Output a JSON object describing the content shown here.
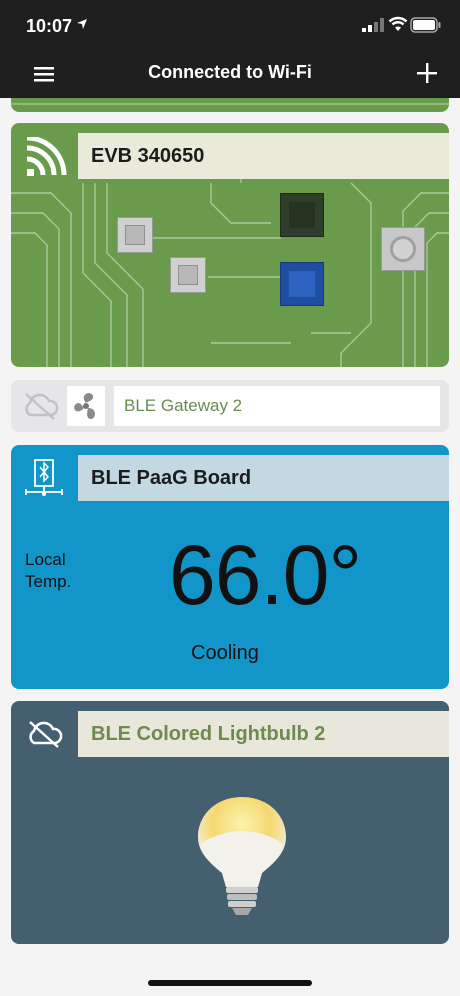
{
  "status_bar": {
    "time": "10:07"
  },
  "nav": {
    "title": "Connected to Wi-Fi"
  },
  "devices": {
    "evb": {
      "name": "EVB 340650"
    },
    "gateway": {
      "name": "BLE Gateway 2"
    },
    "paag": {
      "name": "BLE PaaG Board",
      "sensor_label": "Local\nTemp.",
      "temperature": "66.0°",
      "mode": "Cooling"
    },
    "bulb": {
      "name": "BLE Colored Lightbulb 2"
    }
  },
  "colors": {
    "evb_bg": "#6a9a4c",
    "paag_bg": "#1296c9",
    "bulb_bg": "#445f6f",
    "gateway_text": "#6a8c51"
  },
  "icons": {
    "menu": "hamburger-icon",
    "add": "plus-icon",
    "evb": "wifi-signal-icon",
    "gateway_status": "cloud-off-icon",
    "gateway": "fan-icon",
    "paag": "bluetooth-network-icon",
    "bulb_status": "cloud-off-icon"
  }
}
